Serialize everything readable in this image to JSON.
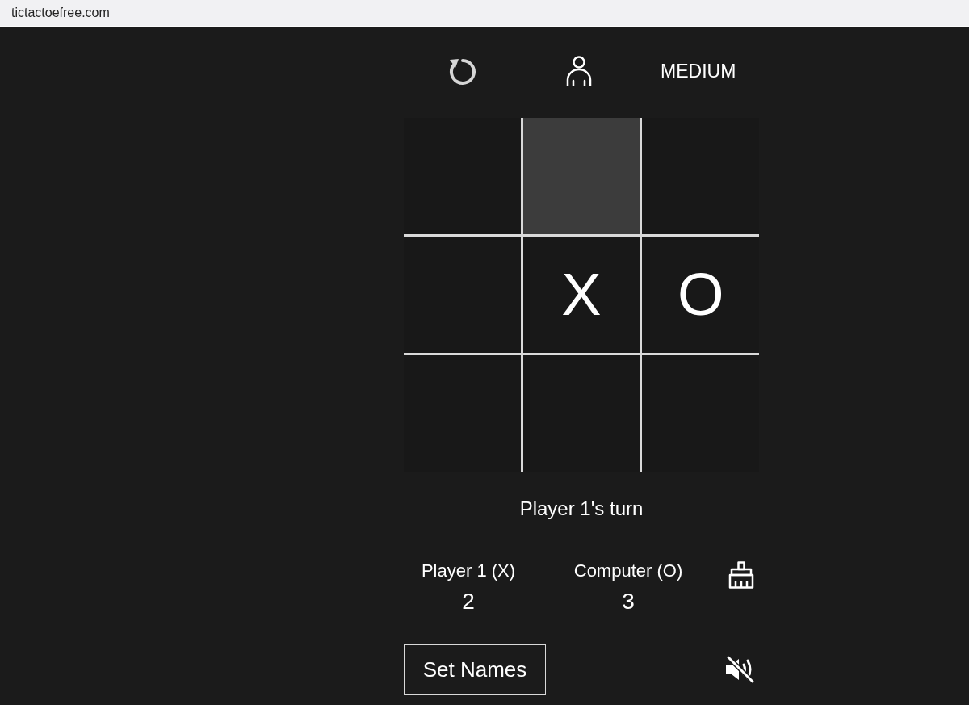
{
  "browser": {
    "url": "tictactoefree.com"
  },
  "toolbar": {
    "difficulty": "MEDIUM"
  },
  "board": {
    "cells": [
      {
        "highlighted": false
      },
      {
        "highlighted": true
      },
      {
        "highlighted": false
      },
      {
        "highlighted": false
      },
      {
        "highlighted": false,
        "mark": "X"
      },
      {
        "highlighted": false,
        "mark": "O"
      },
      {
        "highlighted": false
      },
      {
        "highlighted": false
      },
      {
        "highlighted": false
      }
    ]
  },
  "status": "Player 1's turn",
  "scores": [
    {
      "name": "Player 1 (X)",
      "score": "2"
    },
    {
      "name": "Computer (O)",
      "score": "3"
    }
  ],
  "set_names_button": "Set Names",
  "sound": {
    "muted": true
  }
}
